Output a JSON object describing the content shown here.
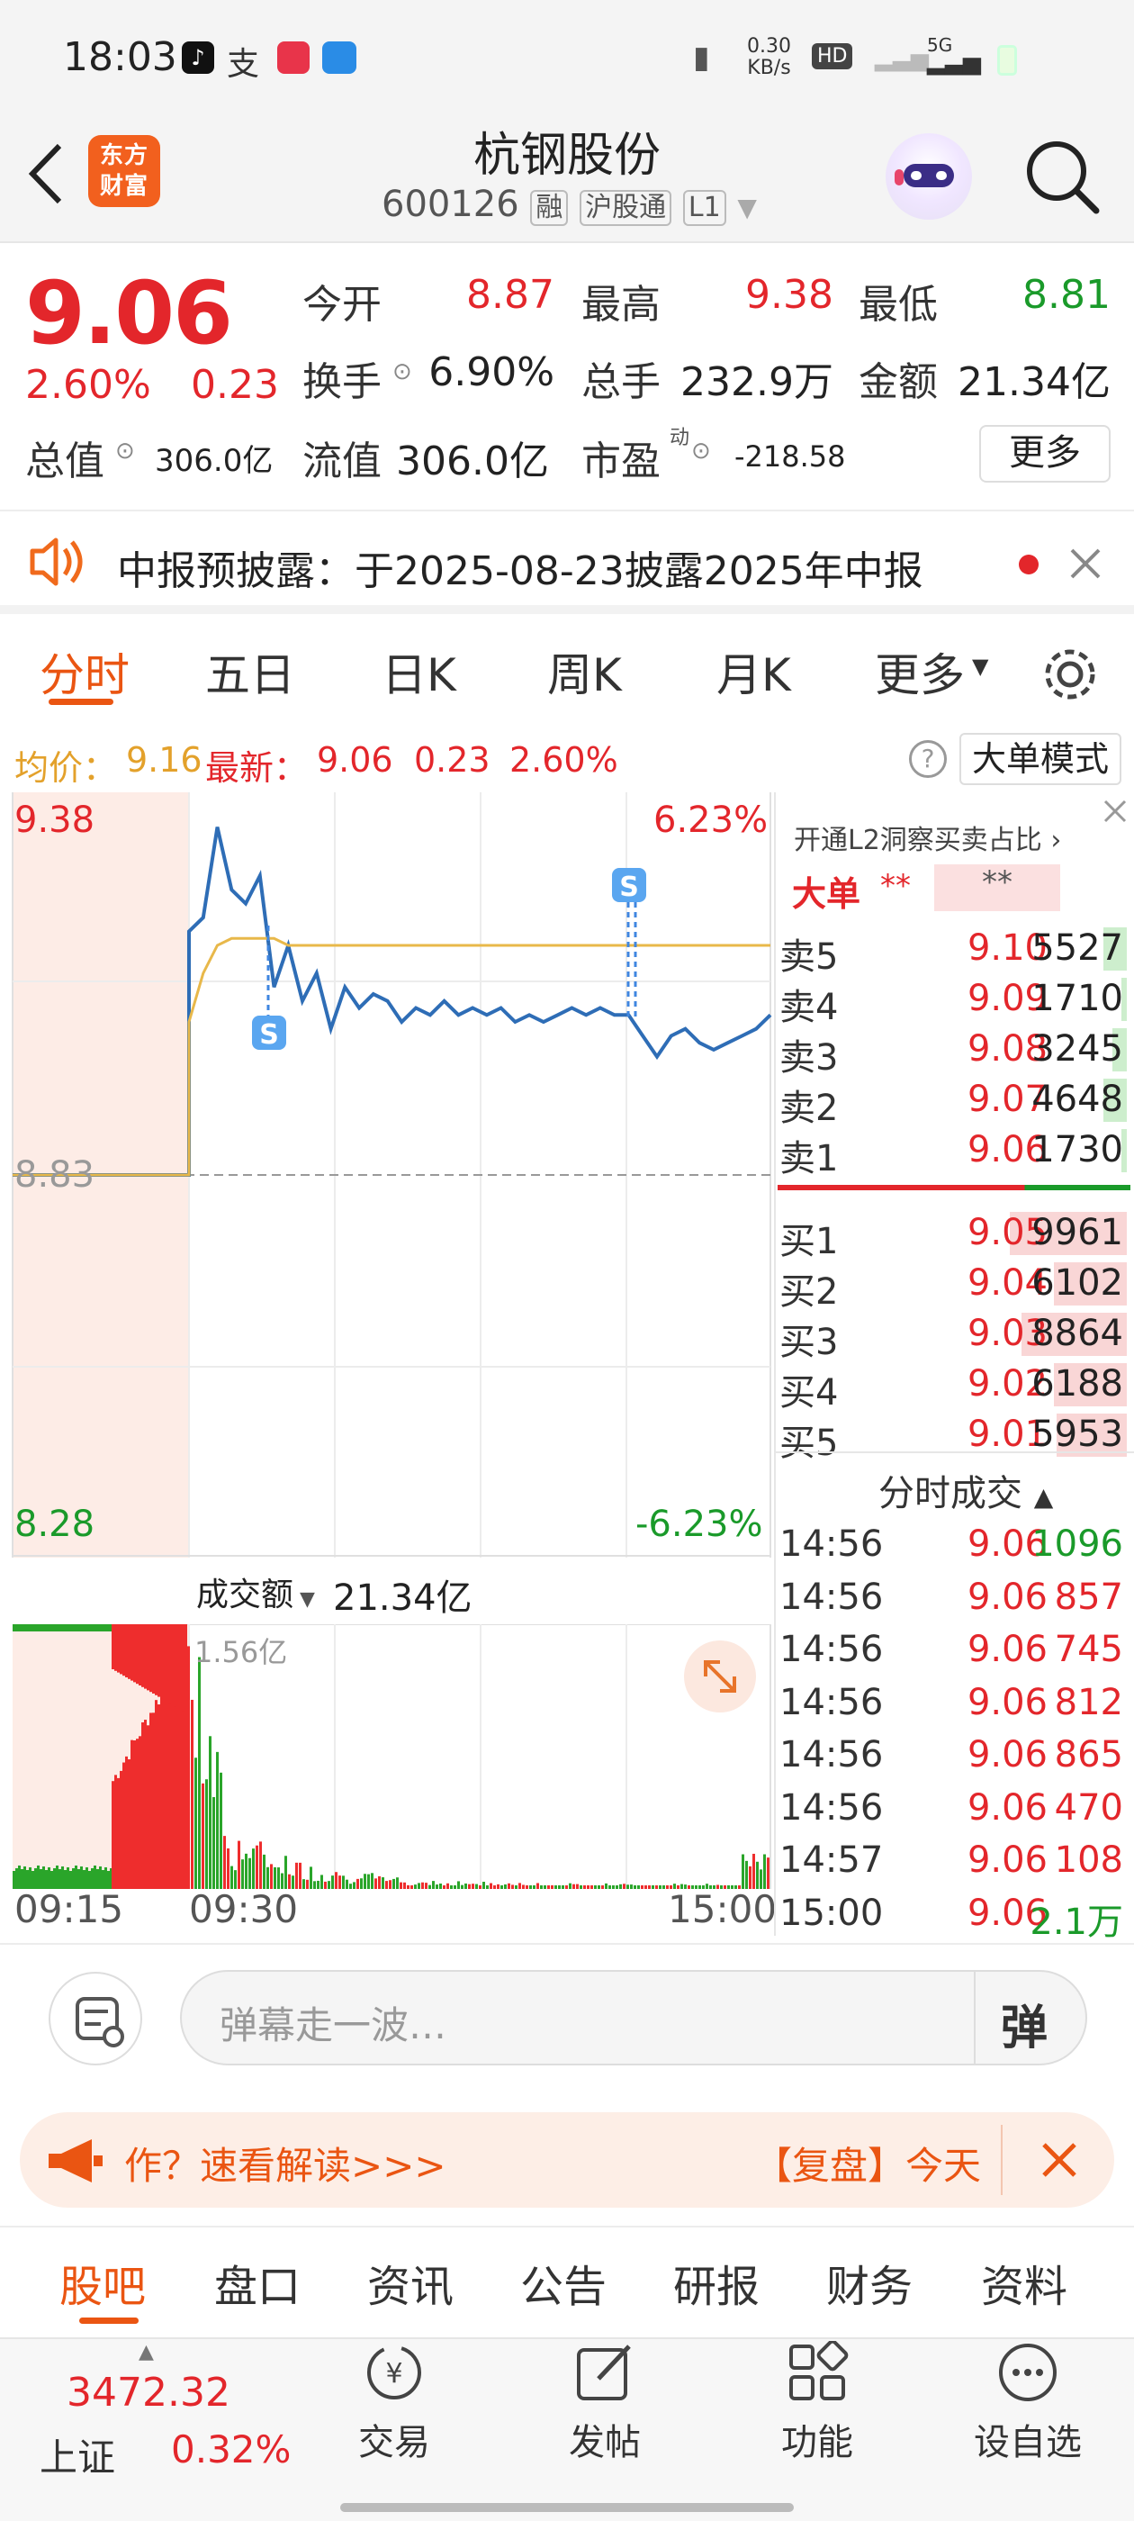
{
  "status_bar": {
    "time": "18:03",
    "net_speed": "0.30\nKB/s",
    "net_top": "0.30",
    "net_bottom": "KB/s",
    "hd": "HD",
    "signal": "5G"
  },
  "header": {
    "title": "杭钢股份",
    "code": "600126",
    "tags": [
      "融",
      "沪股通",
      "L1"
    ],
    "logo_text": "东方财富"
  },
  "quote": {
    "price": "9.06",
    "change_pct": "2.60%",
    "change": "0.23",
    "fields": [
      {
        "label": "今开",
        "value": "8.87",
        "color": "#e3262b"
      },
      {
        "label": "最高",
        "value": "9.38",
        "color": "#e3262b"
      },
      {
        "label": "最低",
        "value": "8.81",
        "color": "#1a9a2a"
      },
      {
        "label": "换手",
        "value": "6.90%",
        "color": "#222222"
      },
      {
        "label": "总手",
        "value": "232.9万",
        "color": "#222222"
      },
      {
        "label": "金额",
        "value": "21.34亿",
        "color": "#222222"
      },
      {
        "label": "总值",
        "value": "306.0亿",
        "color": "#222222"
      },
      {
        "label": "流值",
        "value": "306.0亿",
        "color": "#222222"
      },
      {
        "label": "市盈",
        "value": "-218.58",
        "color": "#222222"
      }
    ],
    "pe_superscript": "动",
    "more_button": "更多"
  },
  "notice": {
    "text": "中报预披露：于2025-08-23披露2025年中报"
  },
  "tabs": {
    "items": [
      "分时",
      "五日",
      "日K",
      "周K",
      "月K",
      "更多"
    ],
    "active": "分时"
  },
  "chart_info": {
    "avg_label": "均价：",
    "avg_value": "9.16",
    "latest_label": "最新：",
    "latest_value": "9.06",
    "latest_change": "0.23",
    "latest_pct": "2.60%",
    "big_order_mode": "大单模式"
  },
  "chart_data": {
    "type": "line",
    "y_axis_left": {
      "top": "9.38",
      "mid": "8.83",
      "bottom": "8.28"
    },
    "y_axis_right": {
      "top": "6.23%",
      "bottom": "-6.23%"
    },
    "ylim": [
      8.28,
      9.38
    ],
    "prev_close": 8.83,
    "series": [
      {
        "values": [
          8.83,
          8.83,
          8.83,
          8.83,
          9.18,
          9.2,
          9.33,
          9.24,
          9.22,
          9.26,
          9.1,
          9.16,
          9.08,
          9.12,
          9.04,
          9.1,
          9.07,
          9.09,
          9.08,
          9.05,
          9.07,
          9.06,
          9.08,
          9.06,
          9.07,
          9.06,
          9.07,
          9.05,
          9.06,
          9.05,
          9.06,
          9.07,
          9.06,
          9.07,
          9.06,
          9.06,
          9.03,
          9.0,
          9.03,
          9.04,
          9.02,
          9.01,
          9.02,
          9.03,
          9.04,
          9.06
        ]
      },
      {
        "values": [
          8.83,
          8.83,
          8.83,
          8.83,
          9.05,
          9.12,
          9.16,
          9.17,
          9.17,
          9.17,
          9.17,
          9.16,
          9.16,
          9.16,
          9.16,
          9.16,
          9.16,
          9.16,
          9.16,
          9.16,
          9.16,
          9.16,
          9.16,
          9.16,
          9.16,
          9.16,
          9.16,
          9.16,
          9.16,
          9.16,
          9.16,
          9.16,
          9.16,
          9.16,
          9.16,
          9.16,
          9.16,
          9.16,
          9.16,
          9.16,
          9.16,
          9.16,
          9.16,
          9.16,
          9.16,
          9.16
        ]
      }
    ],
    "x_ticks": [
      "09:15",
      "09:30",
      "15:00"
    ],
    "volume_label": "成交额",
    "volume_total": "21.34亿",
    "volume_max": "1.56亿"
  },
  "order_book": {
    "promo": "开通L2洞察买卖占比",
    "big_order_label": "大单",
    "big_order_v1": "**",
    "big_order_v2": "**",
    "asks": [
      {
        "label": "卖5",
        "price": "9.10",
        "volume": "5527",
        "fill": 0.2
      },
      {
        "label": "卖4",
        "price": "9.09",
        "volume": "1710",
        "fill": 0.05
      },
      {
        "label": "卖3",
        "price": "9.08",
        "volume": "3245",
        "fill": 0.12
      },
      {
        "label": "卖2",
        "price": "9.07",
        "volume": "4648",
        "fill": 0.2
      },
      {
        "label": "卖1",
        "price": "9.06",
        "volume": "1730",
        "fill": 0.05
      }
    ],
    "bids": [
      {
        "label": "买1",
        "price": "9.05",
        "volume": "9961",
        "fill": 1.0
      },
      {
        "label": "买2",
        "price": "9.04",
        "volume": "6102",
        "fill": 0.62
      },
      {
        "label": "买3",
        "price": "9.03",
        "volume": "8864",
        "fill": 0.9
      },
      {
        "label": "买4",
        "price": "9.02",
        "volume": "6188",
        "fill": 0.62
      },
      {
        "label": "买5",
        "price": "9.01",
        "volume": "5953",
        "fill": 0.6
      }
    ],
    "ticks_title": "分时成交",
    "ticks": [
      {
        "time": "14:56",
        "price": "9.06",
        "volume": "1096",
        "color": "#1a9a2a"
      },
      {
        "time": "14:56",
        "price": "9.06",
        "volume": "857",
        "color": "#e3262b"
      },
      {
        "time": "14:56",
        "price": "9.06",
        "volume": "745",
        "color": "#e3262b"
      },
      {
        "time": "14:56",
        "price": "9.06",
        "volume": "812",
        "color": "#e3262b"
      },
      {
        "time": "14:56",
        "price": "9.06",
        "volume": "865",
        "color": "#e3262b"
      },
      {
        "time": "14:56",
        "price": "9.06",
        "volume": "470",
        "color": "#e3262b"
      },
      {
        "time": "14:57",
        "price": "9.06",
        "volume": "108",
        "color": "#e3262b"
      },
      {
        "time": "15:00",
        "price": "9.06",
        "volume": "2.1万",
        "color": "#1a9a2a"
      }
    ]
  },
  "danmu": {
    "placeholder": "弹幕走一波…",
    "button": "弹"
  },
  "banner": {
    "left_text": "作？速看解读>>>",
    "right_text": "【复盘】今天"
  },
  "bottom_tabs": {
    "items": [
      "股吧",
      "盘口",
      "资讯",
      "公告",
      "研报",
      "财务",
      "资料"
    ],
    "active": "股吧"
  },
  "bottom_nav": {
    "index_value": "3472.32",
    "index_name": "上证",
    "index_pct": "0.32%",
    "items": [
      "交易",
      "发帖",
      "功能",
      "设自选"
    ]
  }
}
